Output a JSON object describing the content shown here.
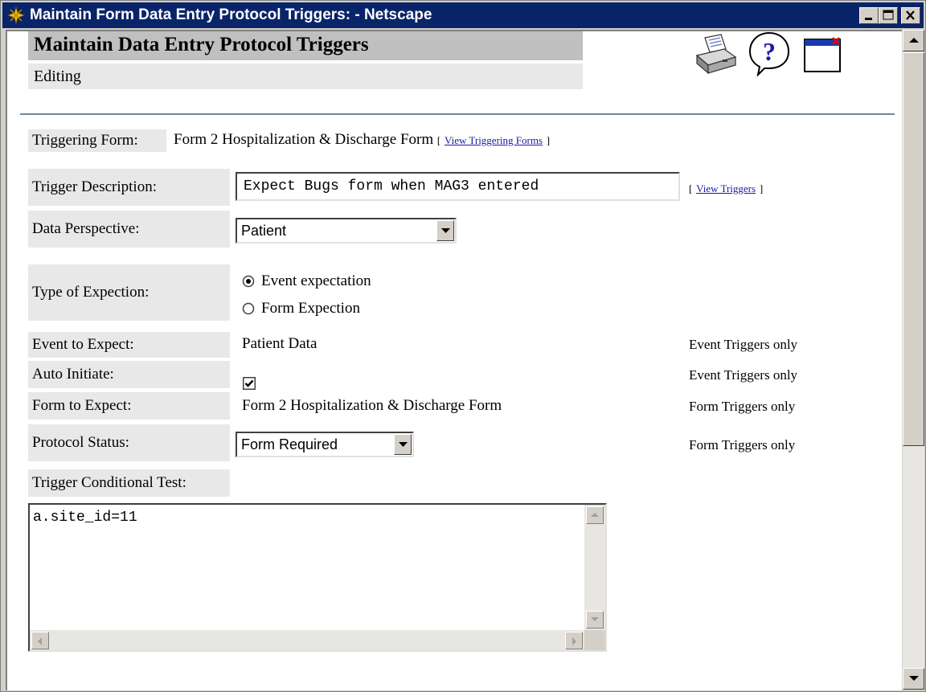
{
  "window": {
    "title": "Maintain Form Data Entry Protocol Triggers: - Netscape"
  },
  "header": {
    "title": "Maintain Data Entry Protocol Triggers",
    "mode": "Editing",
    "icons": [
      "printer-icon",
      "help-icon",
      "close-window-icon"
    ]
  },
  "triggering_form": {
    "label": "Triggering Form:",
    "value": "Form 2 Hospitalization & Discharge Form",
    "link": "View Triggering Forms"
  },
  "trigger_description": {
    "label": "Trigger Description:",
    "value": "Expect Bugs form when MAG3 entered",
    "link": "View Triggers"
  },
  "data_perspective": {
    "label": "Data Perspective:",
    "selected": "Patient"
  },
  "type_of_expection": {
    "label": "Type of Expection:",
    "options": [
      "Event expectation",
      "Form Expection"
    ],
    "selected_index": 0
  },
  "event_to_expect": {
    "label": "Event to Expect:",
    "value": "Patient Data",
    "note": "Event Triggers only"
  },
  "auto_initiate": {
    "label": "Auto Initiate:",
    "checked": true,
    "note": "Event Triggers only"
  },
  "form_to_expect": {
    "label": "Form to Expect:",
    "value": "Form 2 Hospitalization & Discharge Form",
    "note": "Form Triggers only"
  },
  "protocol_status": {
    "label": "Protocol Status:",
    "selected": "Form Required",
    "note": "Form Triggers only"
  },
  "conditional_test": {
    "label": "Trigger Conditional Test:",
    "value": "a.site_id=11"
  },
  "brackets": {
    "open": "[",
    "close": "]"
  }
}
